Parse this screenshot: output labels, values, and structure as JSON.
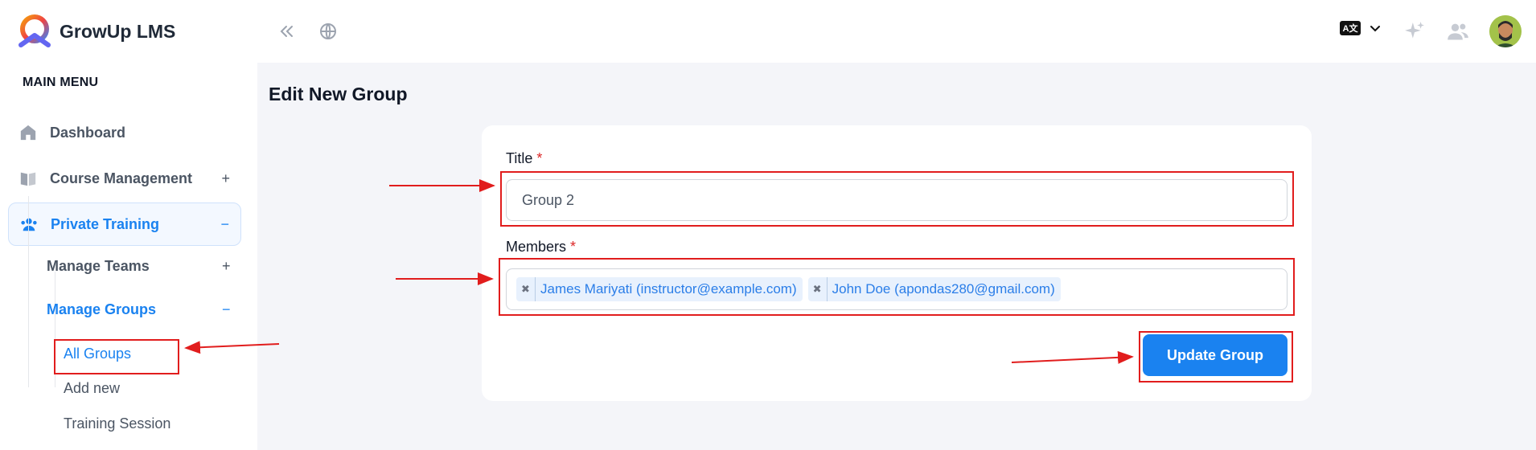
{
  "brand": {
    "name": "GrowUp LMS"
  },
  "topbar": {
    "lang_badge": "A文",
    "icons": [
      "collapse-sidebar-icon",
      "globe-icon",
      "translate-icon",
      "chevron-down-icon",
      "sparkle-icon",
      "users-icon",
      "user-avatar"
    ]
  },
  "sidebar": {
    "heading": "MAIN MENU",
    "items": [
      {
        "label": "Dashboard",
        "icon": "home-icon",
        "toggle": ""
      },
      {
        "label": "Course Management",
        "icon": "book-icon",
        "toggle": "+"
      },
      {
        "label": "Private Training",
        "icon": "users-icon",
        "toggle": "−"
      }
    ],
    "subitems": [
      {
        "label": "Manage Teams",
        "toggle": "+"
      },
      {
        "label": "Manage Groups",
        "toggle": "−"
      }
    ],
    "leaves": [
      "All Groups",
      "Add new",
      "Training Session"
    ]
  },
  "main": {
    "title": "Edit New Group",
    "form": {
      "title_label": "Title",
      "title_value": "Group 2",
      "members_label": "Members",
      "required_mark": "*",
      "members": [
        "James Mariyati (instructor@example.com)",
        "John Doe (apondas280@gmail.com)"
      ],
      "chip_remove": "✖",
      "submit_label": "Update Group"
    }
  },
  "colors": {
    "accent": "#1a82f0",
    "annotation": "#e11d1d",
    "required": "#dc2626"
  }
}
